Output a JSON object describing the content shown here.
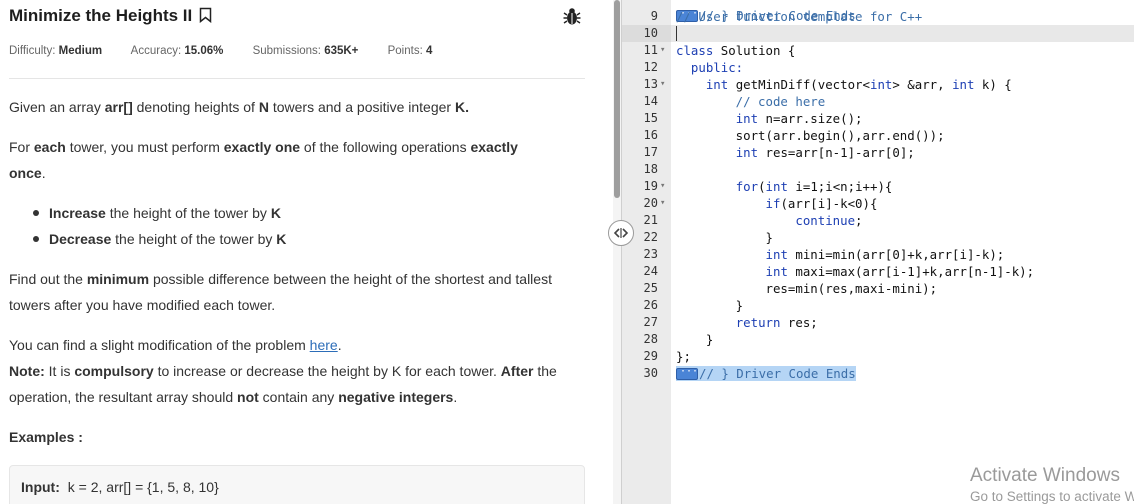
{
  "problem": {
    "title": "Minimize the Heights II",
    "difficulty_label": "Difficulty:",
    "difficulty_value": "Medium",
    "accuracy_label": "Accuracy:",
    "accuracy_value": "15.06%",
    "submissions_label": "Submissions:",
    "submissions_value": "635K+",
    "points_label": "Points:",
    "points_value": "4"
  },
  "statement": {
    "p1": [
      "Given an array ",
      "arr[]",
      " denoting heights of ",
      "N",
      " towers and a positive integer ",
      "K."
    ],
    "p2": [
      "For ",
      "each",
      " tower, you must perform ",
      "exactly one",
      " of the following operations ",
      "exactly",
      " ",
      "once",
      "."
    ],
    "bullets": [
      {
        "bold": "Increase",
        "rest": " the height of the tower by ",
        "k": "K"
      },
      {
        "bold": "Decrease",
        "rest": " the height of the tower by ",
        "k": "K"
      }
    ],
    "p4": [
      "Find out the ",
      "minimum",
      " possible difference between the height of the shortest and tallest towers after you have modified each tower."
    ],
    "p5_text": "You can find a slight modification of the problem ",
    "p5_link": "here",
    "p5_end": ".",
    "p6": [
      "Note:",
      " It is ",
      "compulsory",
      " to increase or decrease the height by K for each tower. ",
      "After",
      " the operation, the resultant array should ",
      "not",
      " contain any ",
      "negative integers",
      "."
    ],
    "examples_label": "Examples :",
    "example_input_label": "Input:",
    "example_input_value": "k = 2, arr[] = {1, 5, 8, 10}"
  },
  "editor": {
    "top_partial": "// } Driver Code Ends",
    "lines": [
      {
        "n": "9",
        "fold": false
      },
      {
        "n": "10",
        "fold": false
      },
      {
        "n": "11",
        "fold": true
      },
      {
        "n": "12",
        "fold": false
      },
      {
        "n": "13",
        "fold": true
      },
      {
        "n": "14",
        "fold": false
      },
      {
        "n": "15",
        "fold": false
      },
      {
        "n": "16",
        "fold": false
      },
      {
        "n": "17",
        "fold": false
      },
      {
        "n": "18",
        "fold": false
      },
      {
        "n": "19",
        "fold": true
      },
      {
        "n": "20",
        "fold": true
      },
      {
        "n": "21",
        "fold": false
      },
      {
        "n": "22",
        "fold": false
      },
      {
        "n": "23",
        "fold": false
      },
      {
        "n": "24",
        "fold": false
      },
      {
        "n": "25",
        "fold": false
      },
      {
        "n": "26",
        "fold": false
      },
      {
        "n": "27",
        "fold": false
      },
      {
        "n": "28",
        "fold": false
      },
      {
        "n": "29",
        "fold": false
      },
      {
        "n": "30",
        "fold": false
      }
    ],
    "code": {
      "l9": "// User function template for C++",
      "l11a": "class",
      "l11b": " Solution {",
      "l12": "  public:",
      "l13a": "    ",
      "l13b": "int",
      "l13c": " getMinDiff(vector<",
      "l13d": "int",
      "l13e": "> &arr, ",
      "l13f": "int",
      "l13g": " k) {",
      "l14": "        // code here",
      "l15a": "        ",
      "l15b": "int",
      "l15c": " n=arr.size();",
      "l16": "        sort(arr.begin(),arr.end());",
      "l17a": "        ",
      "l17b": "int",
      "l17c": " res=arr[n-1]-arr[0];",
      "l19a": "        ",
      "l19b": "for",
      "l19c": "(",
      "l19d": "int",
      "l19e": " i=1;i<n;i++){",
      "l20a": "            ",
      "l20b": "if",
      "l20c": "(arr[i]-k<0){",
      "l21a": "                ",
      "l21b": "continue",
      "l21c": ";",
      "l22": "            }",
      "l23a": "            ",
      "l23b": "int",
      "l23c": " mini=min(arr[0]+k,arr[i]-k);",
      "l24a": "            ",
      "l24b": "int",
      "l24c": " maxi=max(arr[i-1]+k,arr[n-1]-k);",
      "l25": "            res=min(res,maxi-mini);",
      "l26": "        }",
      "l27a": "        ",
      "l27b": "return",
      "l27c": " res;",
      "l28": "    }",
      "l29": "};",
      "l30": "// } Driver Code Ends"
    }
  },
  "watermark": {
    "line1": "Activate Windows",
    "line2": "Go to Settings to activate Windows."
  },
  "colors": {
    "keyword": "#1d3fb3",
    "comment": "#3b6ea8",
    "link": "#2c6db8",
    "selection": "#b5d5f5"
  },
  "icons": [
    "bookmark-icon",
    "bug-icon",
    "splitter-arrows-icon",
    "fold-arrow-icon"
  ]
}
